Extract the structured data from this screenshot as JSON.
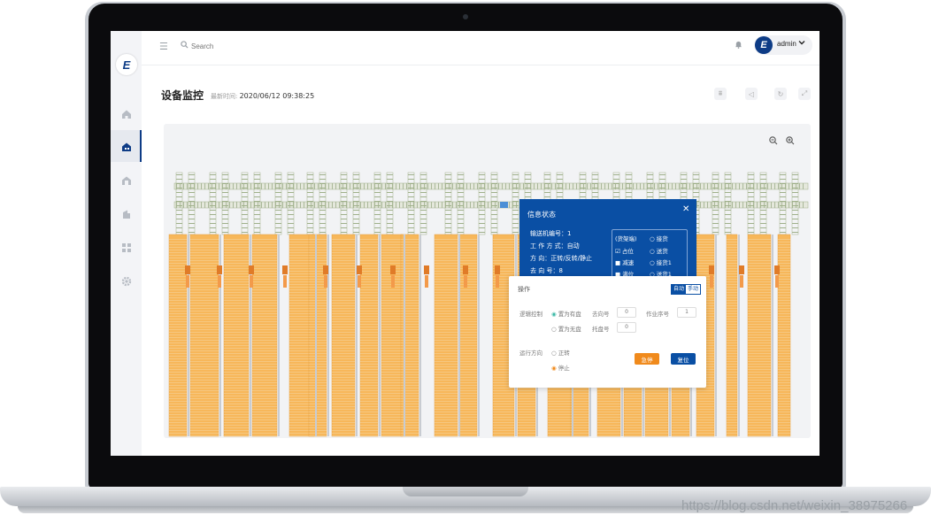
{
  "app": {
    "logo_letter": "E"
  },
  "header": {
    "search_placeholder": "Search",
    "user_initial": "E",
    "username": "admin"
  },
  "page": {
    "title": "设备监控",
    "update_label": "最新时间:",
    "update_time": "2020/06/12 09:38:25"
  },
  "info_popup": {
    "title": "信息状态",
    "lines": [
      "输送机编号：1",
      "工 作 方 式：自动",
      "方      向：正转/反转/静止",
      "去   向   号：8"
    ],
    "status": {
      "legend": "(货架端)",
      "left": [
        "占位",
        "减速",
        "满位"
      ],
      "right": [
        "接货",
        "送货",
        "接货1",
        "送货1"
      ]
    }
  },
  "operation_popup": {
    "title": "操作",
    "mode_auto": "自动",
    "mode_manual": "手动",
    "logic_label": "逻辑控制",
    "opt_has_tray": "置为有盘",
    "opt_no_tray": "置为无盘",
    "dest_label": "去向号",
    "dest_value": "0",
    "seq_label": "作业序号",
    "seq_value": "1",
    "tray_label": "托盘号",
    "tray_value": "0",
    "dir_label": "运行方向",
    "dir_forward": "正转",
    "dir_stop": "停止",
    "estop_label": "急停",
    "reset_label": "复位"
  },
  "colors": {
    "brand": "#0e3c86",
    "popup_blue": "#0a4fa4",
    "rack_orange": "#f7b75a",
    "estop": "#f08a1c"
  },
  "watermark": "https://blog.csdn.net/weixin_38975266"
}
